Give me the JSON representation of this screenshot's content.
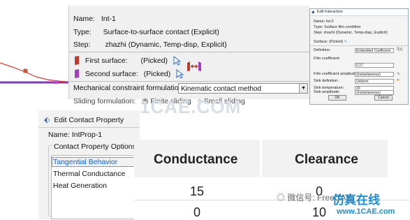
{
  "interaction_dialog": {
    "name_label": "Name:",
    "name_value": "Int-1",
    "type_label": "Type:",
    "type_value": "Surface-to-surface contact (Explicit)",
    "step_label": "Step:",
    "step_value": "zhazhi (Dynamic, Temp-disp, Explicit)",
    "first_surface_label": "First surface:",
    "first_surface_status": "(Picked)",
    "second_surface_label": "Second surface:",
    "second_surface_status": "(Picked)",
    "mech_label": "Mechanical constraint formulation:",
    "mech_value": "Kinematic contact method",
    "sliding_label": "Sliding formulation:",
    "sliding_option_1": "Finite sliding",
    "sliding_option_2": "Small sliding"
  },
  "edit_interaction": {
    "title": "Edit Interaction",
    "name": "Name: Int-2",
    "type": "Type:     Surface film condition",
    "step": "Step:     zhazhi (Dynamic, Temp-disp, Explicit)",
    "surface": "Surface: (Picked)",
    "definition_label": "Definition:",
    "definition_value": "Embedded Coefficient",
    "film_coef_label": "Film coefficient:",
    "film_coef_value": "0.17",
    "film_amp_label": "Film coefficient amplitude:",
    "film_amp_value": "(Instantaneous)",
    "sink_def_label": "Sink definition:",
    "sink_def_value": "Uniform",
    "sink_temp_label": "Sink temperature:",
    "sink_temp_value": "20",
    "sink_amp_label": "Sink amplitude:",
    "sink_amp_value": "(Instantaneous)",
    "ok": "OK",
    "cancel": "Cancel"
  },
  "contact_property": {
    "title": "Edit Contact Property",
    "name": "Name: IntProp-1",
    "group_label": "Contact Property Options",
    "options": [
      "Tangential Behavior",
      "Thermal Conductance",
      "Heat Generation"
    ],
    "selected_index": 0,
    "accent": "#0a64d8"
  },
  "table": {
    "columns": [
      "Conductance",
      "Clearance"
    ],
    "rows": [
      [
        "15",
        "0"
      ],
      [
        "0",
        "10"
      ]
    ]
  },
  "watermark": {
    "big": "1CAE.COM",
    "wechat": "微信号: FreeCAE",
    "brand": "仿真在线",
    "url": "www.1CAE.com"
  }
}
